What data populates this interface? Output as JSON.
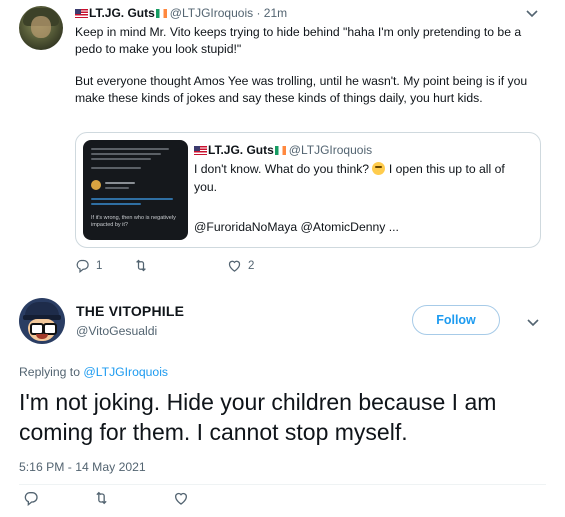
{
  "parent": {
    "display_name": "LT.JG. Guts",
    "handle": "@LTJGIroquois",
    "time": "21m",
    "paragraph1": "Keep in mind Mr. Vito keeps trying to hide behind \"haha I'm only pretending to be a pedo to make you look stupid!\"",
    "paragraph2": "But everyone thought Amos Yee was trolling, until he wasn't. My point being is if you make these kinds of jokes and say these kinds of things daily, you hurt kids.",
    "quote": {
      "display_name": "LT.JG. Guts",
      "handle": "@LTJGIroquois",
      "text_a": "I don't know. What do you think?",
      "text_b": "I open this up to all of you.",
      "mentions": "@FuroridaNoMaya @AtomicDenny ...",
      "image_caption": "If it's wrong, then who is negatively impacted by it?"
    },
    "actions": {
      "reply_count": "1",
      "like_count": "2"
    }
  },
  "main": {
    "display_name": "THE VITOPHILE",
    "handle": "@VitoGesualdi",
    "follow_label": "Follow",
    "replying_prefix": "Replying to",
    "replying_handle": "@LTJGIroquois",
    "text": "I'm not joking. Hide your children because I am coming for them. I cannot stop myself.",
    "timestamp": "5:16 PM - 14 May 2021"
  },
  "icons": {
    "reply": "reply-icon",
    "retweet": "retweet-icon",
    "like": "like-icon",
    "more": "chevron-down-icon"
  },
  "colors": {
    "accent": "#1d9bf0",
    "text": "#0f1419",
    "muted": "#536471",
    "border": "#cfd9de"
  }
}
